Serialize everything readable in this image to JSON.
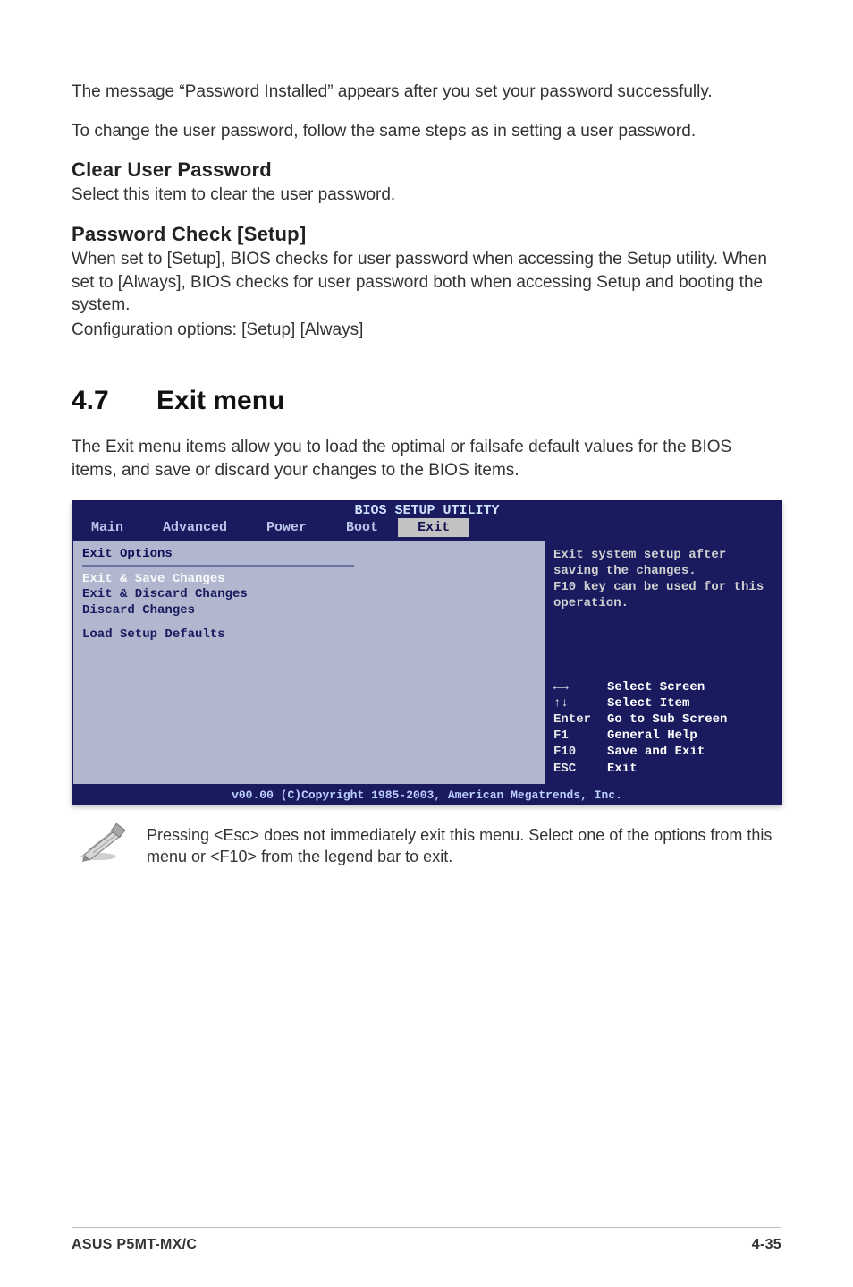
{
  "intro": {
    "p1": "The message “Password Installed” appears after you set your password successfully.",
    "p2": "To change the user password, follow the same steps as in setting a user password."
  },
  "clear_user_password": {
    "heading": "Clear User Password",
    "body": "Select this item to clear the user password."
  },
  "password_check": {
    "heading": "Password Check [Setup]",
    "body1": "When set to [Setup], BIOS checks for user password when accessing the Setup utility. When set to [Always], BIOS checks for user password both when accessing Setup and booting the system.",
    "body2": "Configuration options: [Setup] [Always]"
  },
  "exit_menu": {
    "num": "4.7",
    "title": "Exit menu",
    "intro": "The Exit menu items allow you to load the optimal or failsafe default values for the BIOS items, and save or discard your changes to the BIOS items."
  },
  "bios": {
    "title": "BIOS SETUP UTILITY",
    "tabs": [
      "Main",
      "Advanced",
      "Power",
      "Boot",
      "Exit"
    ],
    "active_tab": "Exit",
    "panel_title": "Exit Options",
    "items": [
      "Exit & Save Changes",
      "Exit & Discard Changes",
      "Discard Changes",
      "Load Setup Defaults"
    ],
    "help_text": "Exit system setup after saving the changes.\nF10 key can be used for this operation.",
    "keys": [
      {
        "k": "←→",
        "d": "Select Screen"
      },
      {
        "k": "↑↓",
        "d": "Select Item"
      },
      {
        "k": "Enter",
        "d": "Go to Sub Screen"
      },
      {
        "k": "F1",
        "d": "General Help"
      },
      {
        "k": "F10",
        "d": "Save and Exit"
      },
      {
        "k": "ESC",
        "d": "Exit"
      }
    ],
    "footer": "v00.00 (C)Copyright 1985-2003, American Megatrends, Inc."
  },
  "note": {
    "text": "Pressing <Esc> does not immediately exit this menu. Select one of the options from this menu or <F10> from the legend bar to exit."
  },
  "page_footer": {
    "left": "ASUS P5MT-MX/C",
    "right": "4-35"
  }
}
